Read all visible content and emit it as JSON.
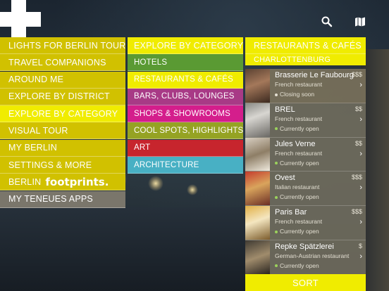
{
  "colors": {
    "yellow_dark": "#d1c100",
    "yellow_bright": "#f0ec00",
    "gray": "#7a766b",
    "green": "#5a9a33",
    "magenta": "#d41e8c",
    "violet": "#a83a86",
    "olive": "#95a323",
    "red": "#c7252d",
    "teal": "#48b0c4",
    "open_status": "#9bd25c"
  },
  "topbar": {
    "logo_icon": "plus-logo",
    "search_icon": "search-icon",
    "map_icon": "map-icon"
  },
  "main_menu": {
    "items": [
      {
        "label": "LIGHTS FOR BERLIN TOUR",
        "state": "normal"
      },
      {
        "label": "TRAVEL COMPANIONS",
        "state": "normal"
      },
      {
        "label": "AROUND ME",
        "state": "normal"
      },
      {
        "label": "EXPLORE BY DISTRICT",
        "state": "normal"
      },
      {
        "label": "EXPLORE BY CATEGORY",
        "state": "active"
      },
      {
        "label": "VISUAL TOUR",
        "state": "normal"
      },
      {
        "label": "MY BERLIN",
        "state": "normal"
      },
      {
        "label": "SETTINGS & MORE",
        "state": "normal"
      },
      {
        "label": "BERLIN",
        "brand": "footprints.",
        "state": "normal"
      },
      {
        "label": "MY TENEUES APPS",
        "state": "gray"
      }
    ]
  },
  "category_menu": {
    "header": "EXPLORE BY CATEGORY",
    "items": [
      {
        "label": "HOTELS",
        "color": "#5a9a33"
      },
      {
        "label": "RESTAURANTS & CAFÉS",
        "color": "#f0ec00"
      },
      {
        "label": "BARS, CLUBS, LOUNGES",
        "color": "#a83a86"
      },
      {
        "label": "SHOPS & SHOWROOMS",
        "color": "#d41e8c"
      },
      {
        "label": "COOL SPOTS, HIGHLIGHTS",
        "color": "#95a323"
      },
      {
        "label": "ART",
        "color": "#c7252d"
      },
      {
        "label": "ARCHITECTURE",
        "color": "#48b0c4"
      }
    ]
  },
  "restaurants": {
    "header": "RESTAURANTS & CAFÉS",
    "district": "CHARLOTTENBURG",
    "items": [
      {
        "name": "Brasserie Le Faubourg",
        "type": "French restaurant",
        "price": "$$$",
        "status": "Closing soon",
        "open": false
      },
      {
        "name": "BREL",
        "type": "French restaurant",
        "price": "$$",
        "status": "Currently open",
        "open": true
      },
      {
        "name": "Jules Verne",
        "type": "French restaurant",
        "price": "$$",
        "status": "Currently open",
        "open": true
      },
      {
        "name": "Ovest",
        "type": "Italian restaurant",
        "price": "$$$",
        "status": "Currently open",
        "open": true
      },
      {
        "name": "Paris Bar",
        "type": "French restaurant",
        "price": "$$$",
        "status": "Currently open",
        "open": true
      },
      {
        "name": "Repke Spätzlerei",
        "type": "German-Austrian restaurant",
        "price": "$",
        "status": "Currently open",
        "open": true
      }
    ],
    "chevron": "›",
    "sort_label": "SORT"
  }
}
